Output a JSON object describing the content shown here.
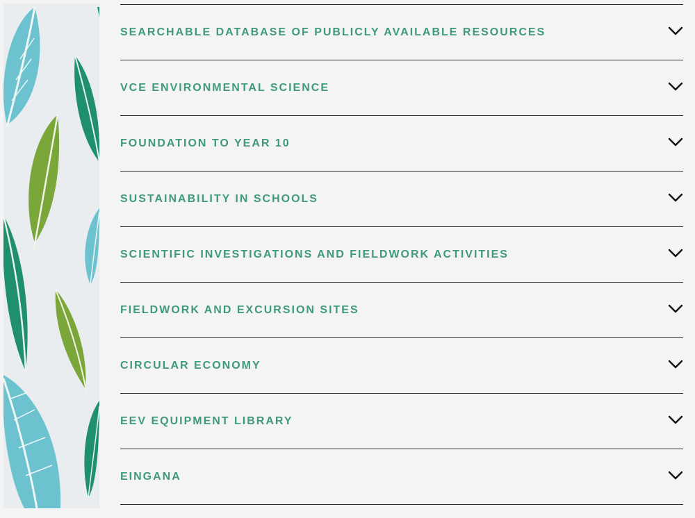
{
  "accordion": {
    "items": [
      {
        "label": "SEARCHABLE DATABASE OF PUBLICLY AVAILABLE RESOURCES",
        "icon": "chevron-down-icon"
      },
      {
        "label": "VCE ENVIRONMENTAL SCIENCE",
        "icon": "chevron-down-icon"
      },
      {
        "label": "FOUNDATION TO YEAR 10",
        "icon": "chevron-down-icon"
      },
      {
        "label": "SUSTAINABILITY IN SCHOOLS",
        "icon": "chevron-down-icon"
      },
      {
        "label": "SCIENTIFIC INVESTIGATIONS AND FIELDWORK ACTIVITIES",
        "icon": "chevron-down-icon"
      },
      {
        "label": "FIELDWORK AND EXCURSION SITES",
        "icon": "chevron-down-icon"
      },
      {
        "label": "CIRCULAR ECONOMY",
        "icon": "chevron-down-icon"
      },
      {
        "label": "EEV EQUIPMENT LIBRARY",
        "icon": "chevron-down-icon"
      },
      {
        "label": "EINGANA",
        "icon": "chevron-down-icon"
      }
    ]
  },
  "colors": {
    "label": "#3f9a78",
    "divider": "#2a2a2a",
    "background": "#f4f4f4",
    "leaf_blue": "#6cc3cf",
    "leaf_teal": "#1f8f6e",
    "leaf_green": "#7aa63a"
  }
}
